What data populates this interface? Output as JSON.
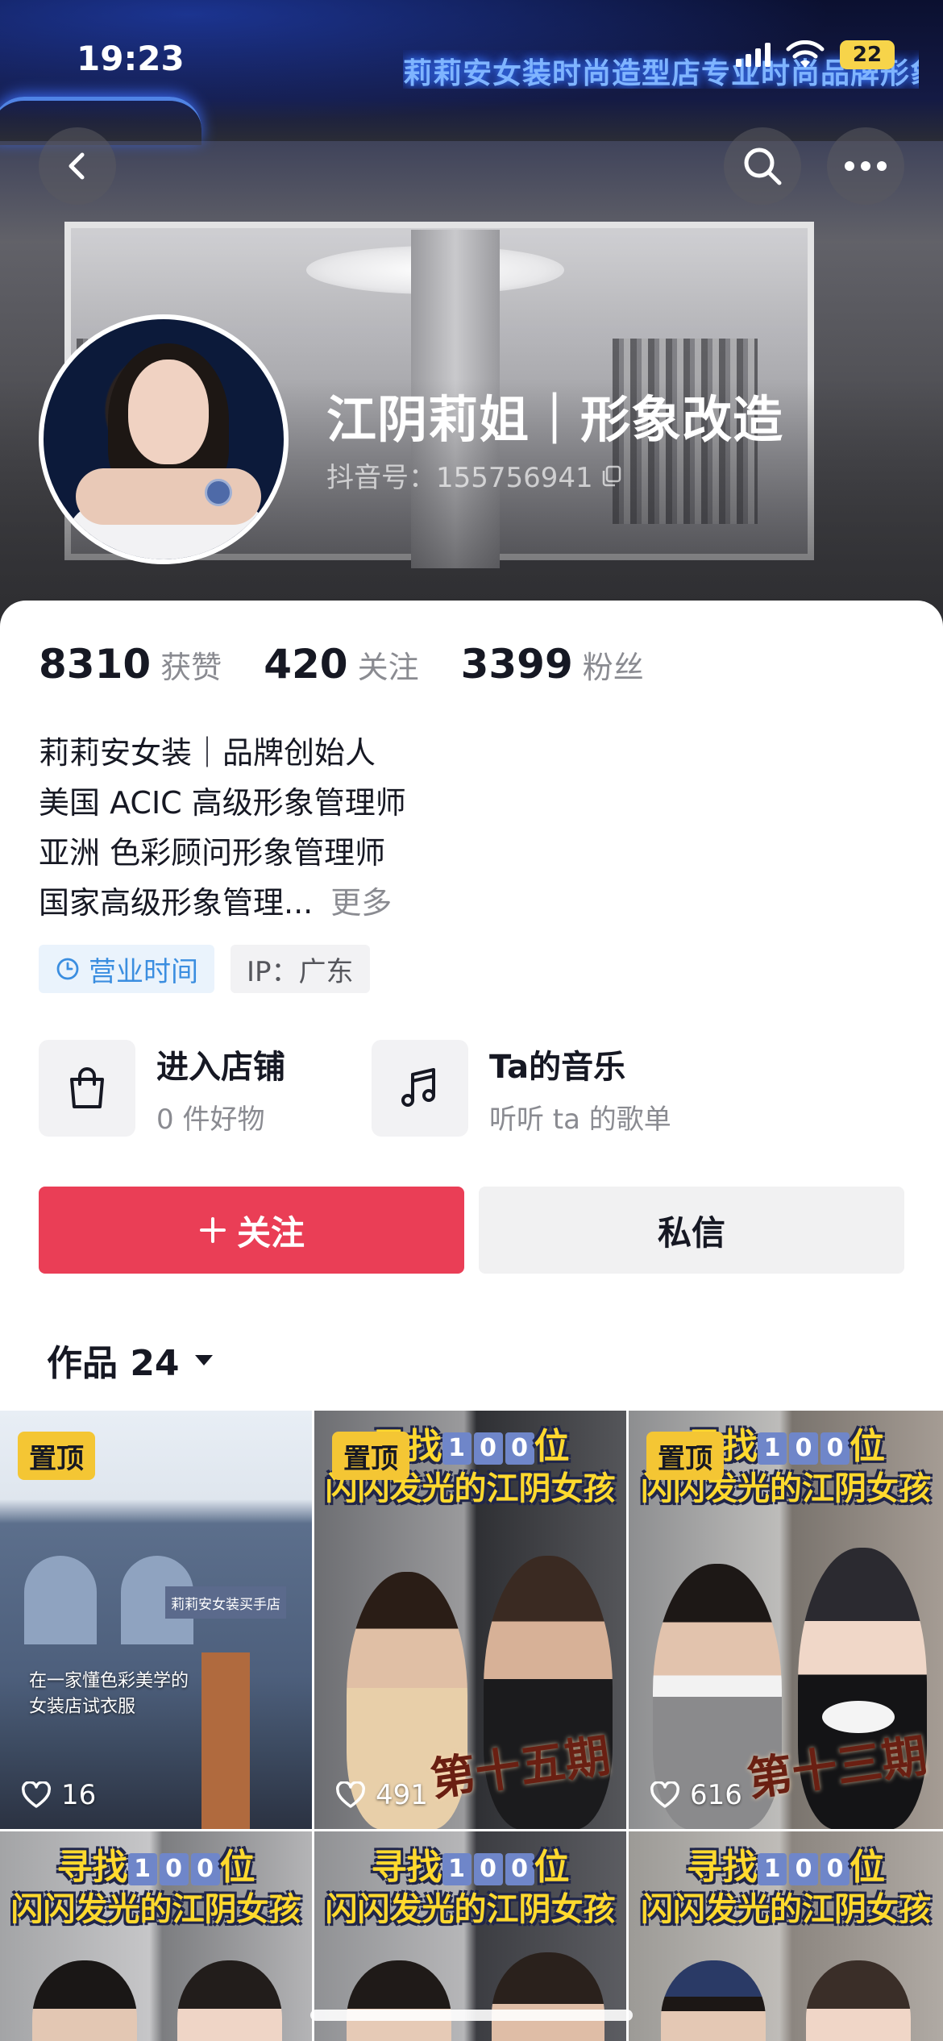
{
  "status_bar": {
    "time": "19:23",
    "battery": "22"
  },
  "header": {
    "neon_sign_text": "莉莉安女装时尚造型店专业时尚品牌形象",
    "name": "江阴莉姐｜形象改造",
    "douyin_id": "抖音号：155756941"
  },
  "stats": [
    {
      "value": "8310",
      "label": "获赞"
    },
    {
      "value": "420",
      "label": "关注"
    },
    {
      "value": "3399",
      "label": "粉丝"
    }
  ],
  "bio": {
    "lines": [
      "莉莉安女装｜品牌创始人",
      "美国  ACIC 高级形象管理师",
      "亚洲  色彩顾问形象管理师",
      "国家高级形象管理..."
    ],
    "more": "更多"
  },
  "tags": {
    "hours": "营业时间",
    "ip": "IP：广东"
  },
  "entries": [
    {
      "title": "进入店铺",
      "subtitle": "0 件好物",
      "icon": "shopping-bag-icon"
    },
    {
      "title": "Ta的音乐",
      "subtitle": "听听 ta 的歌单",
      "icon": "music-note-icon"
    }
  ],
  "actions": {
    "follow": "关注",
    "message": "私信"
  },
  "works_tab": {
    "label": "作品 24"
  },
  "videos": [
    {
      "pinned_label": "置顶",
      "likes": "16",
      "caption_line1": "在一家懂色彩美学的",
      "caption_line2": "女装店试衣服",
      "sign": "莉莉安女装买手店"
    },
    {
      "pinned_label": "置顶",
      "likes": "491",
      "title_top": "寻找",
      "title_num": "100",
      "title_suffix": "位",
      "title_line2": "闪闪发光的江阴女孩",
      "episode": "第十五期"
    },
    {
      "pinned_label": "置顶",
      "likes": "616",
      "title_top": "寻找",
      "title_num": "100",
      "title_suffix": "位",
      "title_line2": "闪闪发光的江阴女孩",
      "episode": "第十三期"
    },
    {
      "title_top": "寻找",
      "title_num": "100",
      "title_suffix": "位",
      "title_line2": "闪闪发光的江阴女孩"
    },
    {
      "title_top": "寻找",
      "title_num": "100",
      "title_suffix": "位",
      "title_line2": "闪闪发光的江阴女孩"
    },
    {
      "title_top": "寻找",
      "title_num": "100",
      "title_suffix": "位",
      "title_line2": "闪闪发光的江阴女孩"
    }
  ],
  "colors": {
    "follow_red": "#ea3e56",
    "pin_yellow": "#f4c634",
    "hours_blue": "#3b8ee0",
    "title_yellow": "#ffd92e"
  }
}
